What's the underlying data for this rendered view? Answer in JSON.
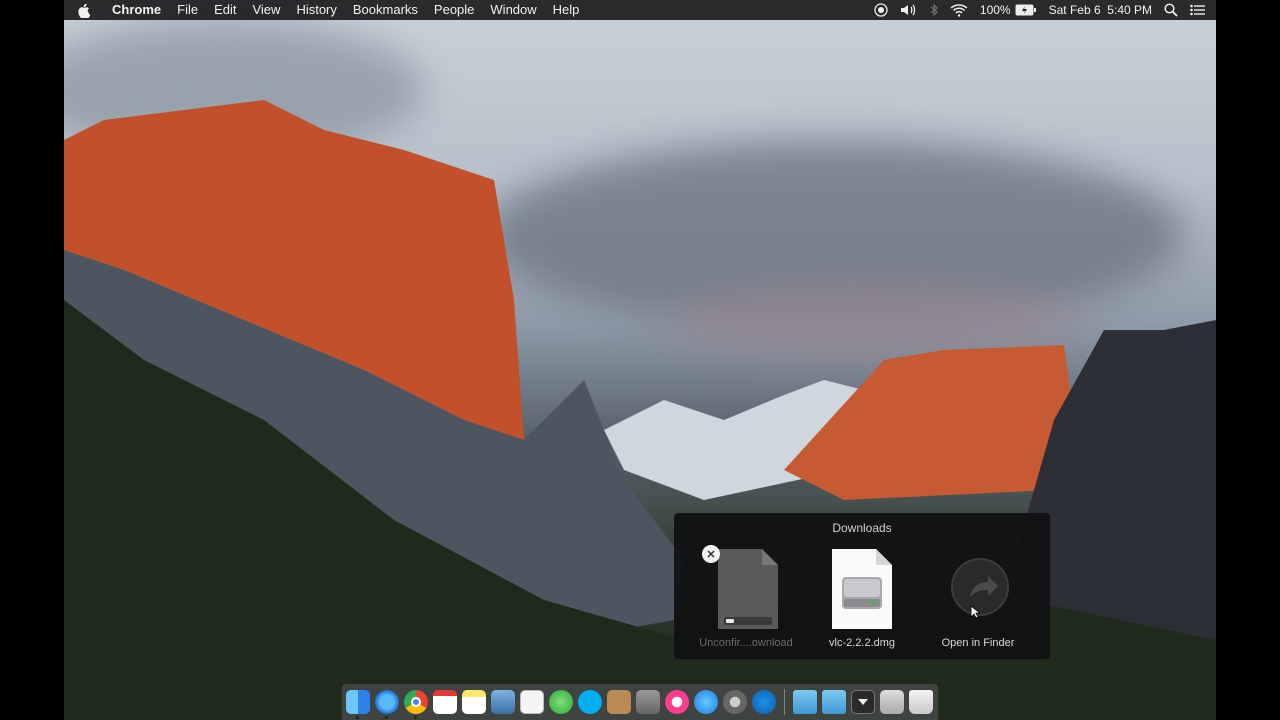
{
  "menubar": {
    "apple_icon": "apple-logo-icon",
    "app_name": "Chrome",
    "items": [
      "File",
      "Edit",
      "View",
      "History",
      "Bookmarks",
      "People",
      "Window",
      "Help"
    ],
    "status": {
      "icons": [
        "record-icon",
        "volume-icon",
        "bluetooth-icon",
        "wifi-icon"
      ],
      "battery_percent": "100%",
      "battery_icon": "battery-charging-icon",
      "datetime": "Sat Feb 6  5:40 PM",
      "search_icon": "spotlight-search-icon",
      "notifications_icon": "notification-center-icon"
    }
  },
  "downloads": {
    "title": "Downloads",
    "items": [
      {
        "label": "Unconfir....ownload",
        "icon": "disk-image-icon",
        "state": "in-progress",
        "remove_icon": "close-icon"
      },
      {
        "label": "vlc-2.2.2.dmg",
        "icon": "dmg-file-icon",
        "state": "complete"
      },
      {
        "label": "Open in Finder",
        "icon": "open-in-finder-icon",
        "state": "action"
      }
    ]
  },
  "dock": {
    "apps": [
      "finder-icon",
      "safari-icon",
      "chrome-icon",
      "calendar-icon",
      "notes-icon",
      "preview-icon",
      "textedit-icon",
      "messages-icon",
      "skype-icon",
      "contacts-icon",
      "photos-icon",
      "itunes-icon",
      "app-store-icon",
      "system-preferences-icon",
      "edge-icon"
    ],
    "stacks": [
      "applications-folder-icon",
      "documents-folder-icon",
      "downloads-stack-icon",
      "screenshot-stack-icon",
      "trash-icon"
    ]
  },
  "colors": {
    "menubar_bg": "#1c1c1e",
    "popover_bg": "#101012",
    "accent_orange": "#d4552a"
  }
}
